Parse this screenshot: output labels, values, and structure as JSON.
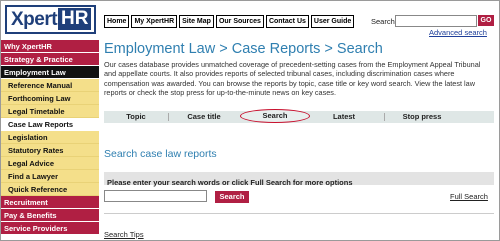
{
  "header": {
    "logo_text": "Xpert",
    "logo_accent": "HR",
    "nav": [
      "Home",
      "My XpertHR",
      "Site Map",
      "Our Sources",
      "Contact Us",
      "User Guide"
    ],
    "search_label": "Search",
    "search_value": "",
    "go_label": "GO",
    "advanced_search": "Advanced search"
  },
  "sidebar": {
    "items": [
      {
        "label": "Why XpertHR"
      },
      {
        "label": "Strategy & Practice"
      },
      {
        "label": "Employment Law"
      },
      {
        "label": "Reference Manual"
      },
      {
        "label": "Forthcoming Law"
      },
      {
        "label": "Legal Timetable"
      },
      {
        "label": "Case Law Reports"
      },
      {
        "label": "Legislation"
      },
      {
        "label": "Statutory Rates"
      },
      {
        "label": "Legal Advice"
      },
      {
        "label": "Find a Lawyer"
      },
      {
        "label": "Quick Reference"
      },
      {
        "label": "Recruitment"
      },
      {
        "label": "Pay & Benefits"
      },
      {
        "label": "Service Providers"
      }
    ]
  },
  "main": {
    "title": "Employment Law > Case Reports > Search",
    "description": "Our cases database provides unmatched coverage of precedent-setting cases from the Employment Appeal Tribunal and appellate courts. It also provides reports of selected tribunal cases, including discrimination cases where compensation was awarded. You can browse the reports by topic, case title or key word search. View the latest law reports or check the stop press for up-to-the-minute news on key cases.",
    "tabs": [
      "Topic",
      "Case title",
      "Search",
      "Latest",
      "Stop press"
    ],
    "section_title": "Search case law reports",
    "instruction": "Please enter your search words or click Full Search for more options",
    "keyword_value": "",
    "search_button": "Search",
    "full_search": "Full Search",
    "search_tips": "Search Tips"
  },
  "colors": {
    "brand_red": "#b01f43",
    "brand_navy": "#1f3f7a",
    "heading_blue": "#2f7fb0",
    "sub_nav_yellow": "#f4df8a",
    "tab_highlight": "#c8102e"
  }
}
